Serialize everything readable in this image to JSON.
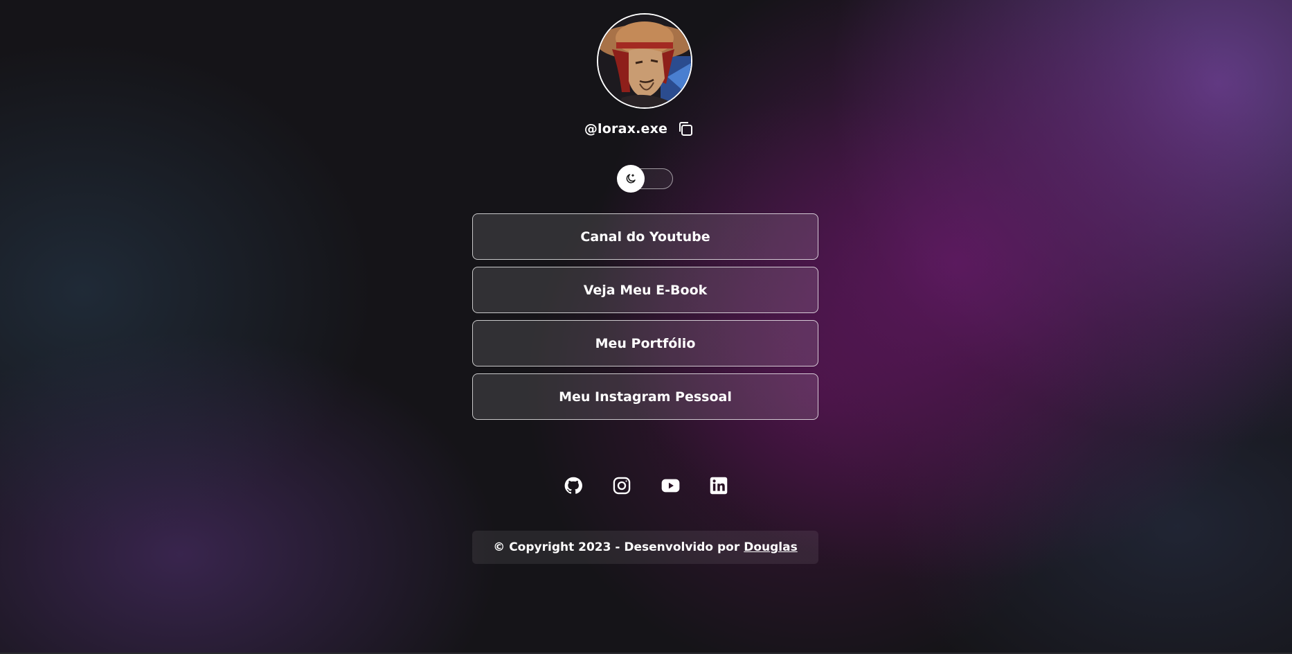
{
  "profile": {
    "avatar_icon": "avatar-illustration",
    "handle": "@lorax.exe",
    "copy_icon": "copy-icon"
  },
  "theme_toggle": {
    "icon": "moon-icon",
    "state": "dark"
  },
  "links": [
    {
      "label": "Canal do Youtube"
    },
    {
      "label": "Veja Meu E-Book"
    },
    {
      "label": "Meu Portfólio"
    },
    {
      "label": "Meu Instagram Pessoal"
    }
  ],
  "socials": [
    {
      "icon": "github-icon"
    },
    {
      "icon": "instagram-icon"
    },
    {
      "icon": "youtube-icon"
    },
    {
      "icon": "linkedin-icon"
    }
  ],
  "footer": {
    "text": "© Copyright 2023 - Desenvolvido por",
    "author": "Douglas"
  },
  "colors": {
    "background": "#151418",
    "accent_purple": "#6a1a6c",
    "text": "#ffffff"
  }
}
